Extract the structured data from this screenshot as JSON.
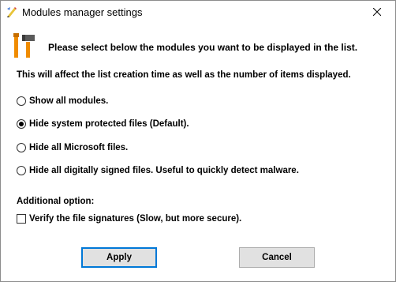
{
  "window": {
    "title": "Modules manager settings"
  },
  "heading": "Please select below the modules you want to be displayed in the list.",
  "info": "This will affect the list creation time as well as the number of items displayed.",
  "options": [
    {
      "label": "Show all modules.",
      "checked": false
    },
    {
      "label": "Hide system protected files (Default).",
      "checked": true
    },
    {
      "label": "Hide all Microsoft files.",
      "checked": false
    },
    {
      "label": "Hide all digitally signed files. Useful to quickly detect malware.",
      "checked": false
    }
  ],
  "additional": {
    "heading": "Additional option:",
    "verify_label": "Verify the file signatures (Slow, but more secure).",
    "verify_checked": false
  },
  "buttons": {
    "apply": "Apply",
    "cancel": "Cancel"
  },
  "colors": {
    "default_button_border": "#0078d7",
    "button_face": "#e1e1e1",
    "icon_orange": "#f08c00"
  },
  "icons": {
    "app": "pen-icon",
    "tools": "hammer-wrench-icon",
    "close": "close-icon"
  }
}
